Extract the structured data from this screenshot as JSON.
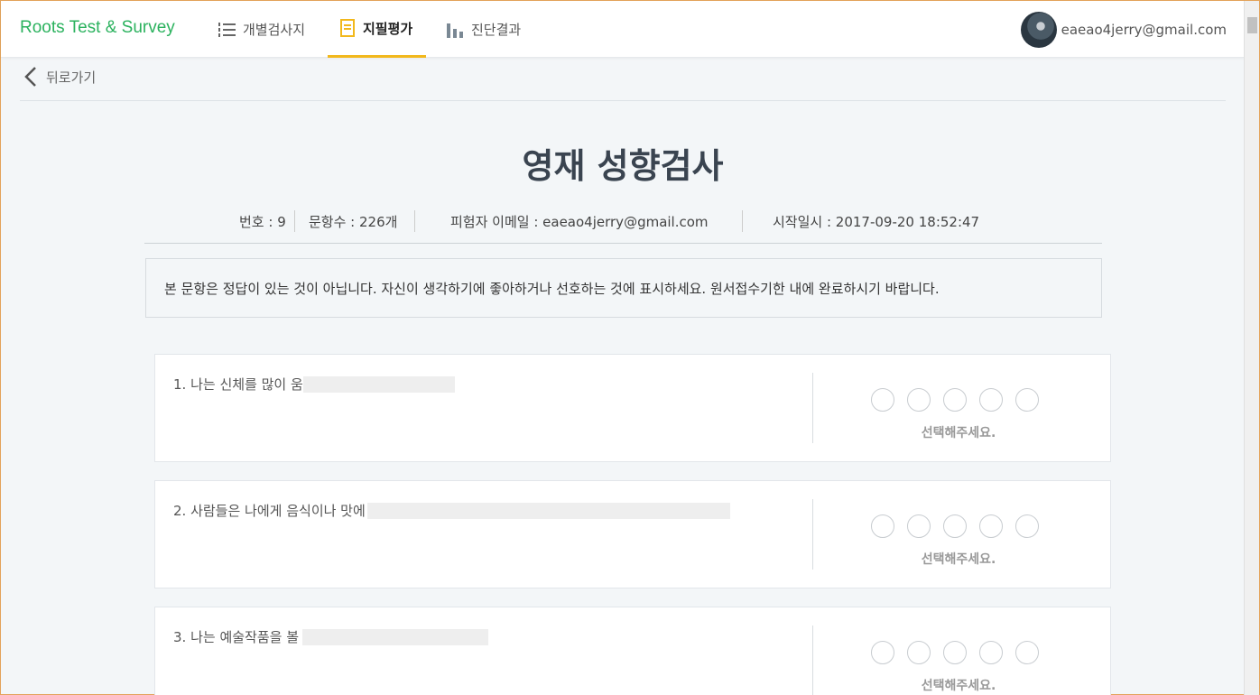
{
  "header": {
    "brand": "Roots Test & Survey",
    "nav": [
      {
        "label": "개별검사지",
        "icon": "list-icon"
      },
      {
        "label": "지필평가",
        "icon": "document-icon"
      },
      {
        "label": "진단결과",
        "icon": "bar-chart-icon"
      }
    ],
    "user_email": "eaeao4jerry@gmail.com"
  },
  "back_label": "뒤로가기",
  "page_title": "영재 성향검사",
  "meta": {
    "number": "번호 : 9",
    "item_count": "문항수 : 226개",
    "examinee_email": "피험자 이메일 : eaeao4jerry@gmail.com",
    "start_time": "시작일시 : 2017-09-20 18:52:47"
  },
  "notice": "본 문항은 정답이 있는 것이 아닙니다. 자신이 생각하기에 좋아하거나 선호하는 것에 표시하세요. 원서접수기한 내에 완료하시기 바랍니다.",
  "questions": [
    {
      "text": "1. 나는 신체를 많이 움"
    },
    {
      "text": "2. 사람들은 나에게 음식이나 맛에"
    },
    {
      "text": "3. 나는 예술작품을 볼"
    }
  ],
  "choose_prompt": "선택해주세요.",
  "colors": {
    "brand": "#2bb25e",
    "active_tab": "#f2b81c"
  }
}
